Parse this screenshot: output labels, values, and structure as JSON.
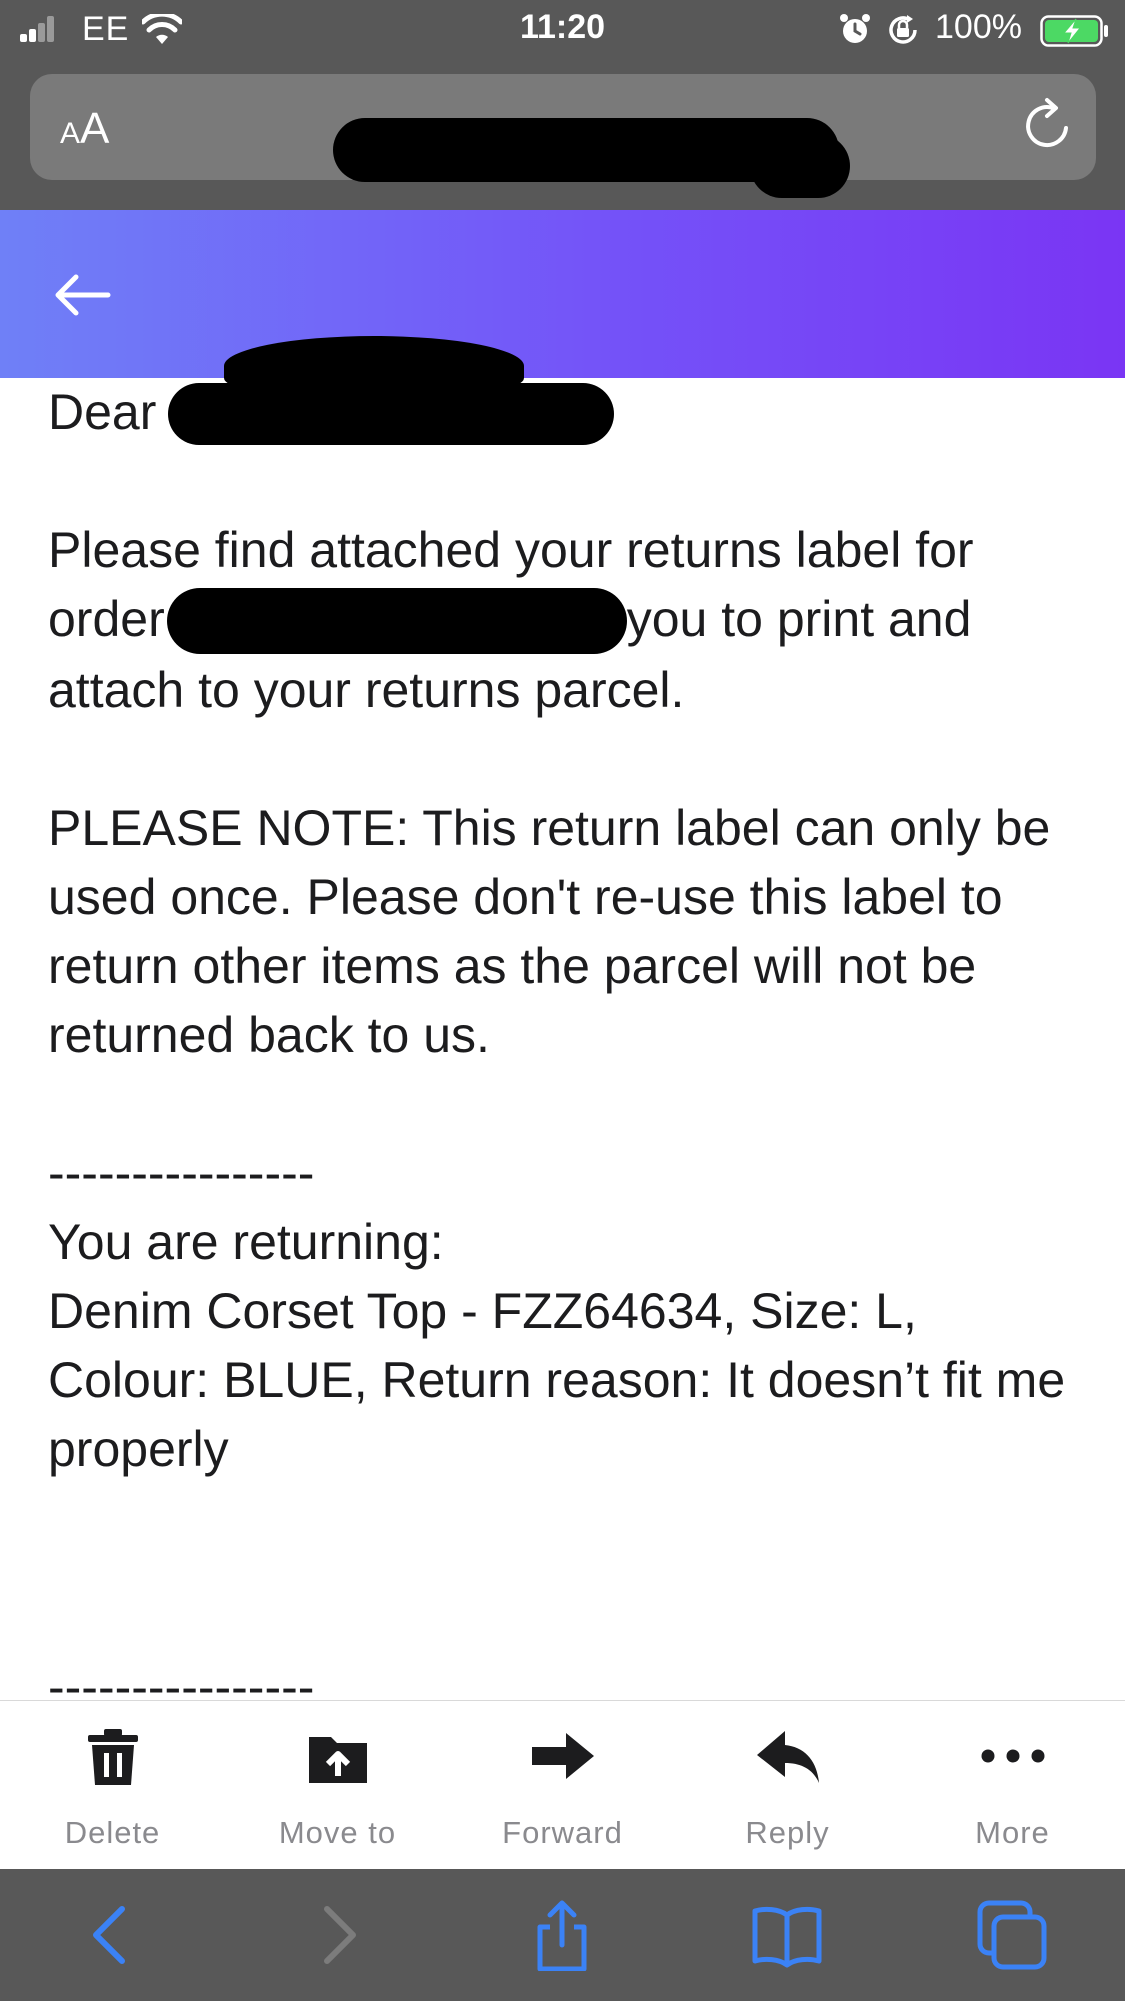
{
  "status_bar": {
    "carrier": "EE",
    "time": "11:20",
    "battery_percent": "100%",
    "signal_bars": 2,
    "charging": true
  },
  "url_bar": {
    "text_size_label": "AA",
    "url_redacted": true
  },
  "email": {
    "greeting": "Dear",
    "para1_line1": "Please find attached your returns label for",
    "para1_line2_start": "order",
    "para1_line2_end": "you to print and",
    "para1_line3": "attach to your returns parcel.",
    "note": "PLEASE NOTE: This return label can only be used once. Please don't re-use this label to return other items as the parcel will not be returned back to us.",
    "divider1": "----------------",
    "returning_heading": "You are returning:",
    "item_line": "Denim Corset Top - FZZ64634, Size: L, Colour: BLUE, Return reason: It doesn’t fit me properly",
    "divider2": "----------------"
  },
  "toolbar": {
    "delete": "Delete",
    "move_to": "Move to",
    "forward": "Forward",
    "reply": "Reply",
    "more": "More"
  },
  "colors": {
    "header_gradient_start": "#6f80f7",
    "header_gradient_end": "#7a35f4",
    "chrome_gray": "#585858",
    "safari_blue": "#3b82f6"
  }
}
